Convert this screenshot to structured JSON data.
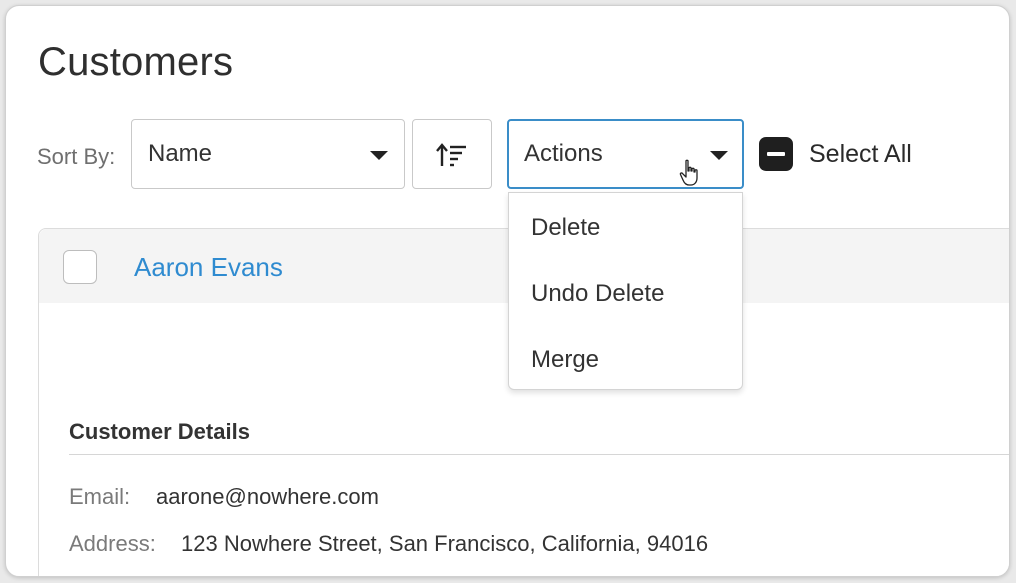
{
  "page": {
    "title": "Customers"
  },
  "toolbar": {
    "sort_label": "Sort By:",
    "sort_value": "Name",
    "actions_label": "Actions",
    "select_all_label": "Select All"
  },
  "actions_menu": {
    "items": [
      {
        "label": "Delete"
      },
      {
        "label": "Undo Delete"
      },
      {
        "label": "Merge"
      }
    ]
  },
  "customer": {
    "name": "Aaron Evans",
    "details_title": "Customer Details",
    "email_label": "Email:",
    "email_value": "aarone@nowhere.com",
    "address_label": "Address:",
    "address_value": "123 Nowhere Street, San Francisco, California, 94016"
  },
  "colors": {
    "accent": "#2f8bd0",
    "focus_border": "#3a8dc8",
    "checkbox_fill": "#1f1f1f"
  },
  "icons": {
    "sort_direction": "sort-ascending-icon",
    "caret": "caret-down-icon",
    "cursor": "hand-pointer-icon",
    "indeterminate_checkbox": "minus-checkbox-icon"
  }
}
